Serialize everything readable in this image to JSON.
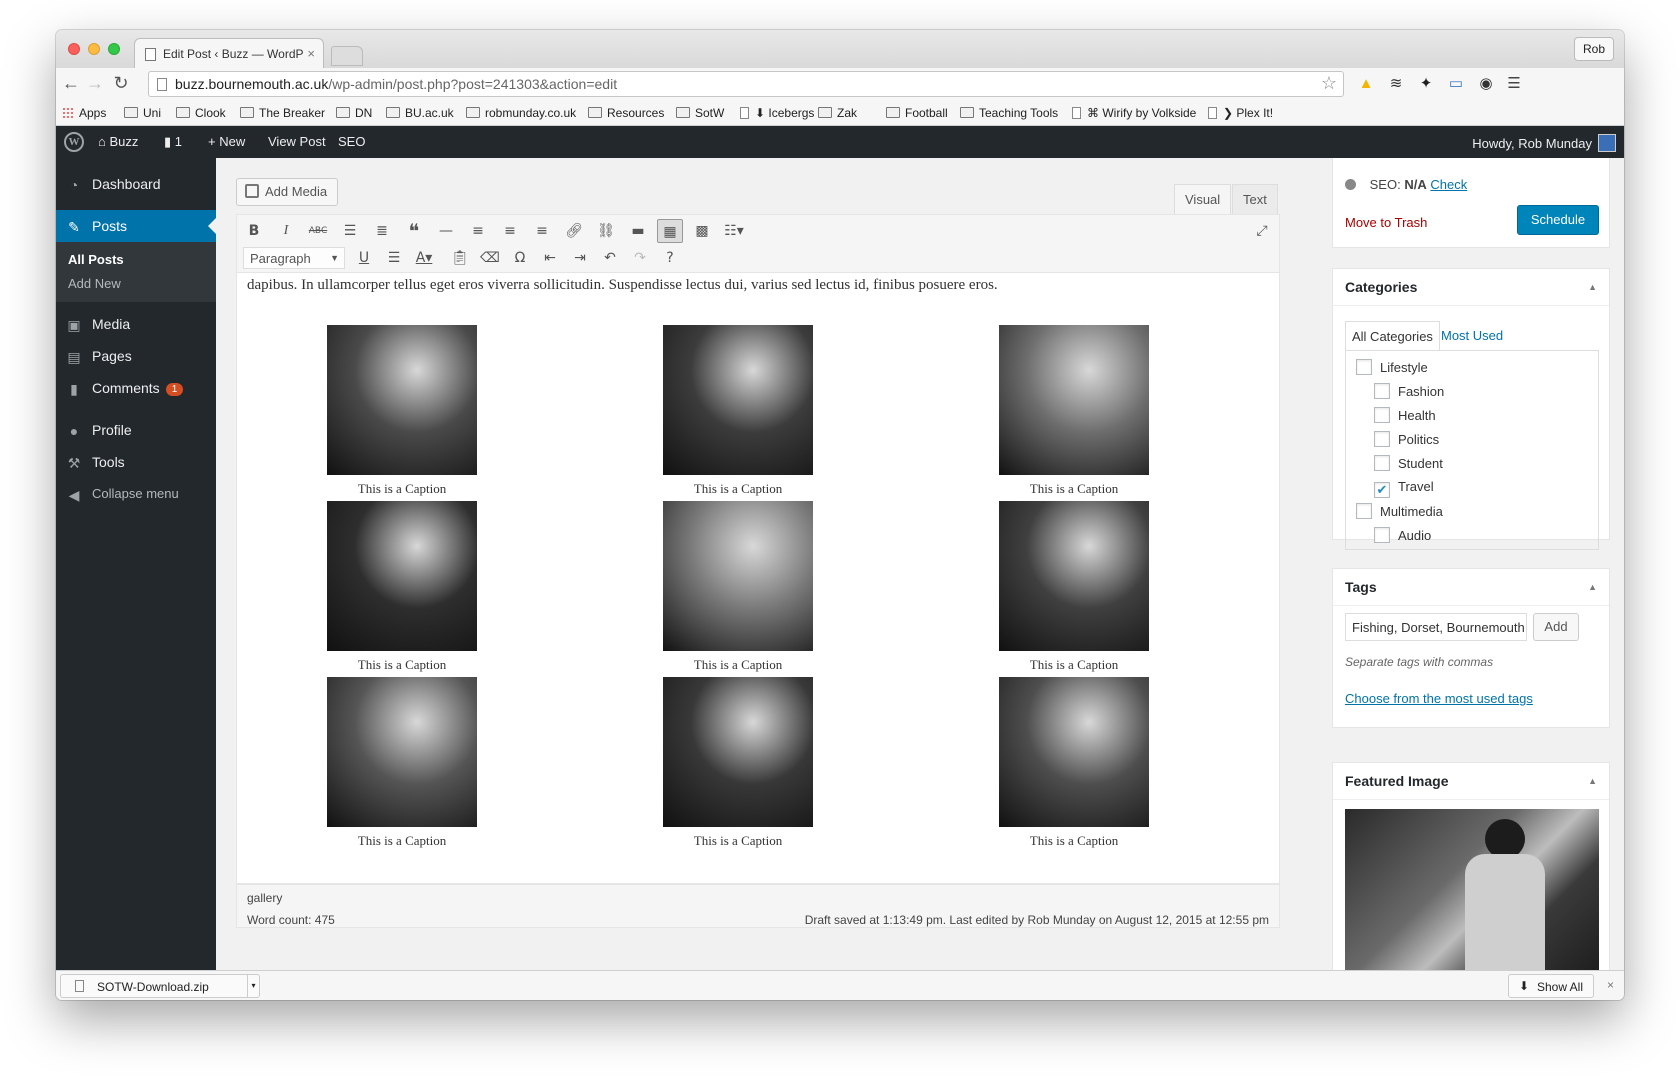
{
  "browser": {
    "tab_title": "Edit Post ‹ Buzz — WordP",
    "user": "Rob",
    "url_host": "buzz.bournemouth.ac.uk",
    "url_path": "/wp-admin/post.php?post=241303&action=edit",
    "bookmarks": [
      {
        "label": "Apps",
        "kind": "apps"
      },
      {
        "label": "Uni",
        "kind": "folder"
      },
      {
        "label": "Clook",
        "kind": "folder"
      },
      {
        "label": "The Breaker",
        "kind": "folder"
      },
      {
        "label": "DN",
        "kind": "folder"
      },
      {
        "label": "BU.ac.uk",
        "kind": "folder"
      },
      {
        "label": "robmunday.co.uk",
        "kind": "folder"
      },
      {
        "label": "Resources",
        "kind": "folder"
      },
      {
        "label": "SotW",
        "kind": "folder"
      },
      {
        "label": "⬇ Icebergs",
        "kind": "page"
      },
      {
        "label": "Zak",
        "kind": "folder"
      },
      {
        "label": "Football",
        "kind": "folder"
      },
      {
        "label": "Teaching Tools",
        "kind": "folder"
      },
      {
        "label": "⌘ Wirify by Volkside",
        "kind": "page"
      },
      {
        "label": "❯ Plex It!",
        "kind": "page"
      }
    ]
  },
  "adminbar": {
    "site": "Buzz",
    "comments_count": "1",
    "new": "New",
    "view_post": "View Post",
    "seo": "SEO",
    "howdy": "Howdy, Rob Munday"
  },
  "sidebar": {
    "items": [
      {
        "label": "Dashboard",
        "icon": "dashboard-icon"
      },
      {
        "label": "Posts",
        "icon": "pin-icon"
      },
      {
        "label": "Media",
        "icon": "media-icon"
      },
      {
        "label": "Pages",
        "icon": "pages-icon"
      },
      {
        "label": "Comments",
        "icon": "comment-icon",
        "badge": "1"
      },
      {
        "label": "Profile",
        "icon": "user-icon"
      },
      {
        "label": "Tools",
        "icon": "wrench-icon"
      },
      {
        "label": "Collapse menu",
        "icon": "collapse-icon"
      }
    ],
    "submenu": [
      "All Posts",
      "Add New"
    ]
  },
  "editor": {
    "add_media": "Add Media",
    "tab_visual": "Visual",
    "tab_text": "Text",
    "format": "Paragraph",
    "paragraph": "dapibus. In ullamcorper tellus eget eros viverra sollicitudin. Suspendisse lectus dui, varius sed lectus id, finibus posuere eros.",
    "captions": [
      "This is a Caption",
      "This is a Caption",
      "This is a Caption",
      "This is a Caption",
      "This is a Caption",
      "This is a Caption",
      "This is a Caption",
      "This is a Caption",
      "This is a Caption"
    ],
    "path": "gallery",
    "word_count": "Word count: 475",
    "saved": "Draft saved at 1:13:49 pm. Last edited by Rob Munday on August 12, 2015 at 12:55 pm"
  },
  "publish": {
    "seo_label": "SEO:",
    "seo_value": "N/A",
    "seo_check": "Check",
    "trash": "Move to Trash",
    "schedule": "Schedule"
  },
  "categories": {
    "title": "Categories",
    "tab_all": "All Categories",
    "tab_most": "Most Used",
    "items": [
      {
        "label": "Lifestyle",
        "checked": false,
        "child": false
      },
      {
        "label": "Fashion",
        "checked": false,
        "child": true
      },
      {
        "label": "Health",
        "checked": false,
        "child": true
      },
      {
        "label": "Politics",
        "checked": false,
        "child": true
      },
      {
        "label": "Student",
        "checked": false,
        "child": true
      },
      {
        "label": "Travel",
        "checked": true,
        "child": true
      },
      {
        "label": "Multimedia",
        "checked": false,
        "child": false
      },
      {
        "label": "Audio",
        "checked": false,
        "child": true
      }
    ]
  },
  "tags": {
    "title": "Tags",
    "input_value": "Fishing, Dorset, Bournemouth",
    "add": "Add",
    "hint": "Separate tags with commas",
    "choose": "Choose from the most used tags"
  },
  "featured": {
    "title": "Featured Image"
  },
  "downloads": {
    "file": "SOTW-Download.zip",
    "show_all": "Show All"
  },
  "colors": {
    "wp_blue": "#0073aa",
    "admin_dark": "#23282d",
    "trash_red": "#a00",
    "badge_orange": "#d54e21"
  }
}
